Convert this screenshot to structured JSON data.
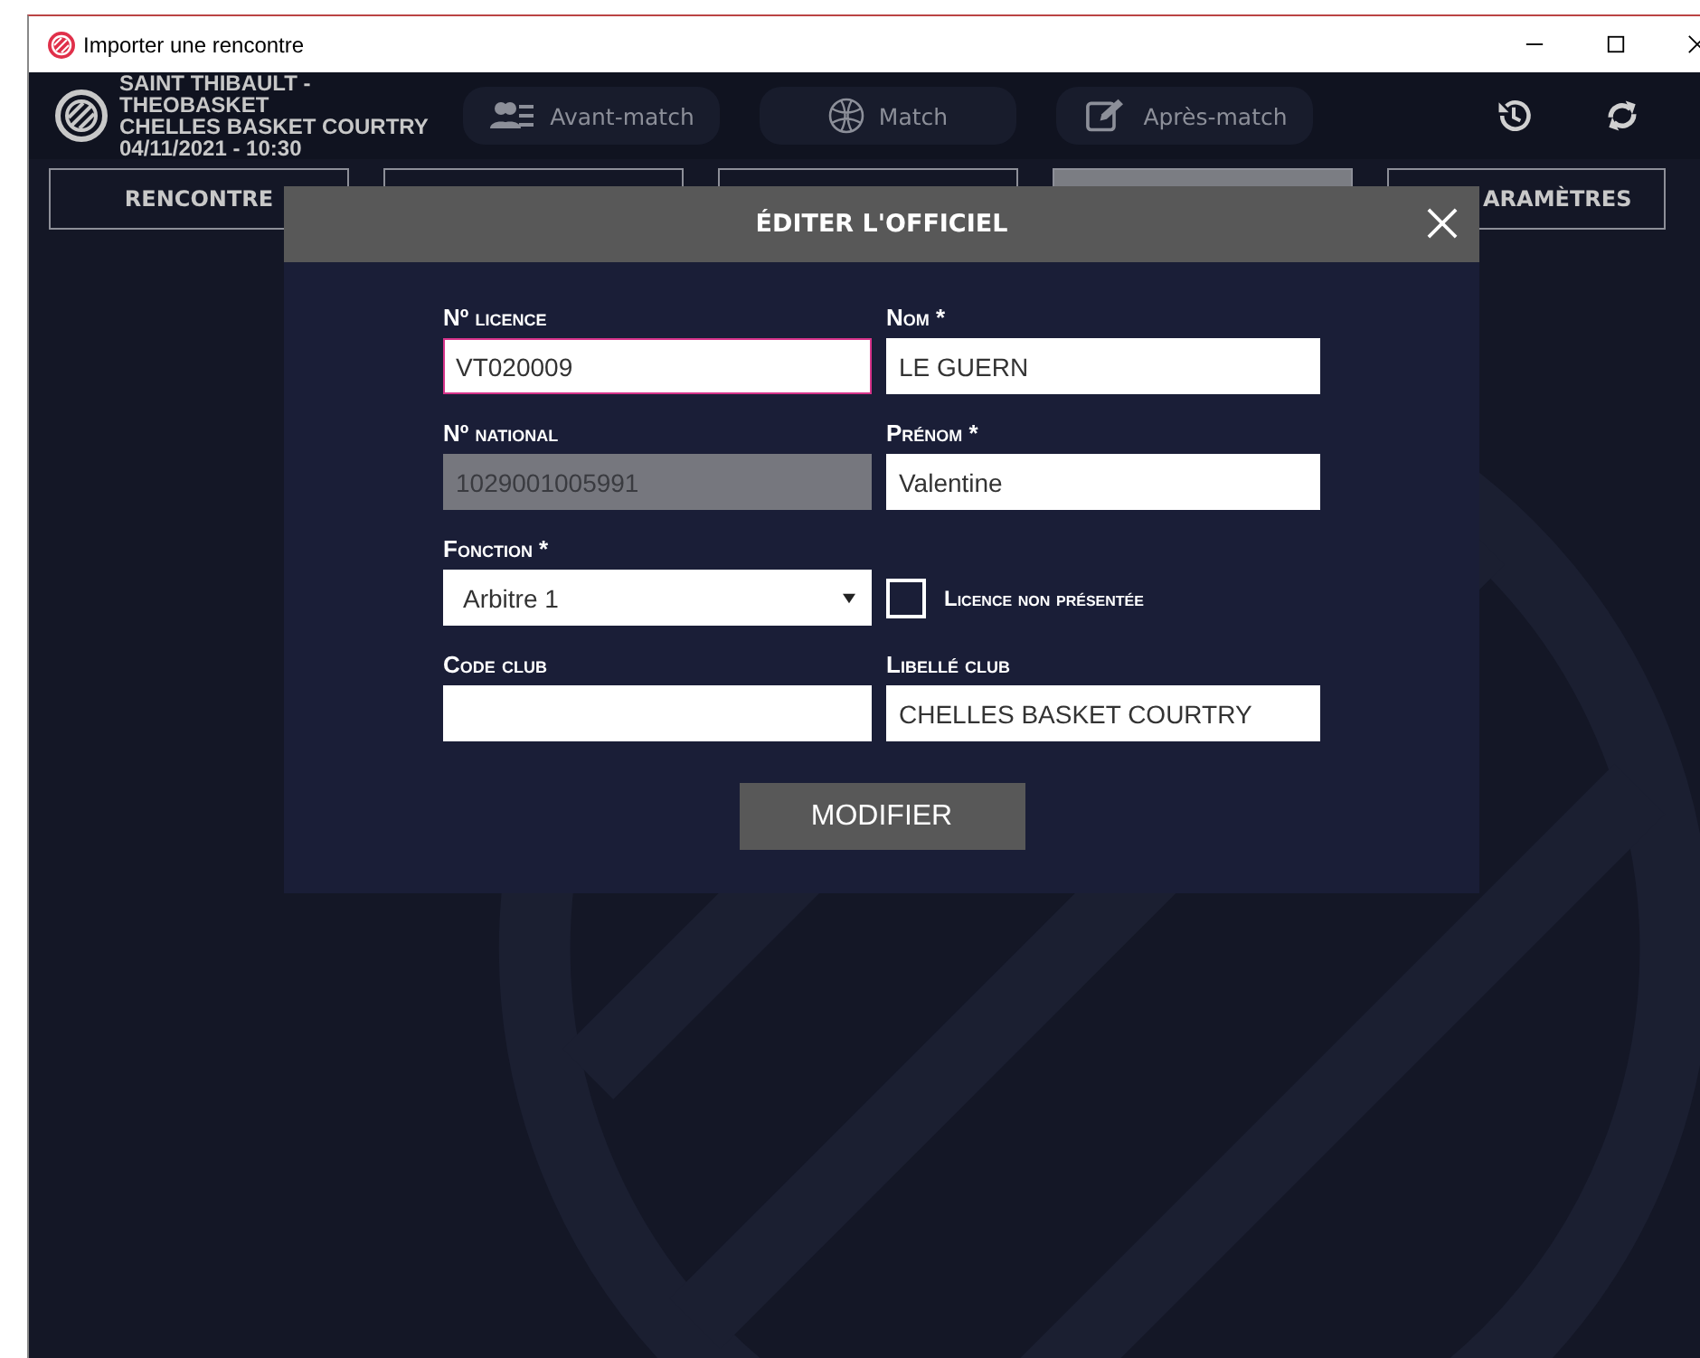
{
  "window": {
    "title": "Importer une rencontre"
  },
  "header": {
    "match_lines": [
      "SAINT THIBAULT - THEOBASKET",
      "CHELLES BASKET COURTRY",
      "04/11/2021 - 10:30"
    ],
    "nav": [
      {
        "label": "Avant-match",
        "kind": "people"
      },
      {
        "label": "Match",
        "kind": "ball"
      },
      {
        "label": "Après-match",
        "kind": "edit"
      }
    ]
  },
  "tabs": [
    {
      "label": "RENCONTRE",
      "selected": false
    },
    {
      "selected": false
    },
    {
      "selected": false
    },
    {
      "selected": true
    },
    {
      "label": "ARAMÈTRES",
      "selected": false
    }
  ],
  "dialog": {
    "title": "ÉDITER L'OFFICIEL",
    "fields": [
      {
        "kind": "text",
        "label": "Nº licence",
        "value": "VT020009",
        "focused": true,
        "disabled": false
      },
      {
        "kind": "text",
        "label": "Nom *",
        "value": "LE GUERN",
        "focused": false,
        "disabled": false
      },
      {
        "kind": "text",
        "label": "Nº national",
        "value": "1029001005991",
        "focused": false,
        "disabled": true
      },
      {
        "kind": "text",
        "label": "Prénom *",
        "value": "Valentine",
        "focused": false,
        "disabled": false
      },
      {
        "kind": "select",
        "label": "Fonction *",
        "value": "Arbitre 1"
      },
      {
        "kind": "checkbox",
        "label": "Licence non présentée",
        "checked": false
      },
      {
        "kind": "text",
        "label": "Code club",
        "focused": false,
        "disabled": false
      },
      {
        "kind": "text",
        "label": "Libellé club",
        "value": "CHELLES BASKET COURTRY",
        "focused": false,
        "disabled": false
      }
    ],
    "button": "MODIFIER"
  }
}
